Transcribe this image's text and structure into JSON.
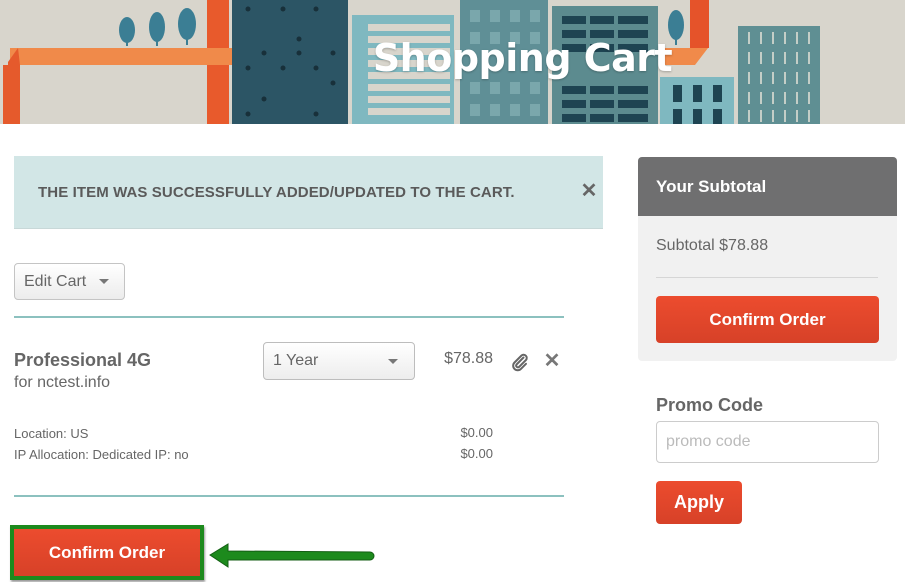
{
  "banner": {
    "title": "Shopping Cart"
  },
  "alert": {
    "message": "THE ITEM WAS SUCCESSFULLY ADDED/UPDATED TO THE CART.",
    "close_icon": "close-icon"
  },
  "cart": {
    "edit_cart_label": "Edit Cart",
    "item": {
      "name": "Professional 4G",
      "domain": "for nctest.info",
      "period": "1 Year",
      "price": "$78.88",
      "attach_icon": "paperclip-icon",
      "remove_icon": "close-icon",
      "details": [
        {
          "label": "Location: US",
          "price": "$0.00"
        },
        {
          "label": "IP Allocation: Dedicated IP: no",
          "price": "$0.00"
        }
      ]
    },
    "confirm_label": "Confirm Order"
  },
  "sidebar": {
    "subtotal_title": "Your Subtotal",
    "subtotal_text": "Subtotal $78.88",
    "confirm_label": "Confirm Order",
    "promo_label": "Promo Code",
    "promo_placeholder": "promo code",
    "promo_value": "",
    "apply_label": "Apply"
  },
  "colors": {
    "accent_red": "#e34a2c",
    "alert_bg": "#d2e6e6",
    "divider": "#8cc1bf",
    "sidebar_header": "#6f6f70",
    "highlight_green": "#1d8a1d"
  }
}
